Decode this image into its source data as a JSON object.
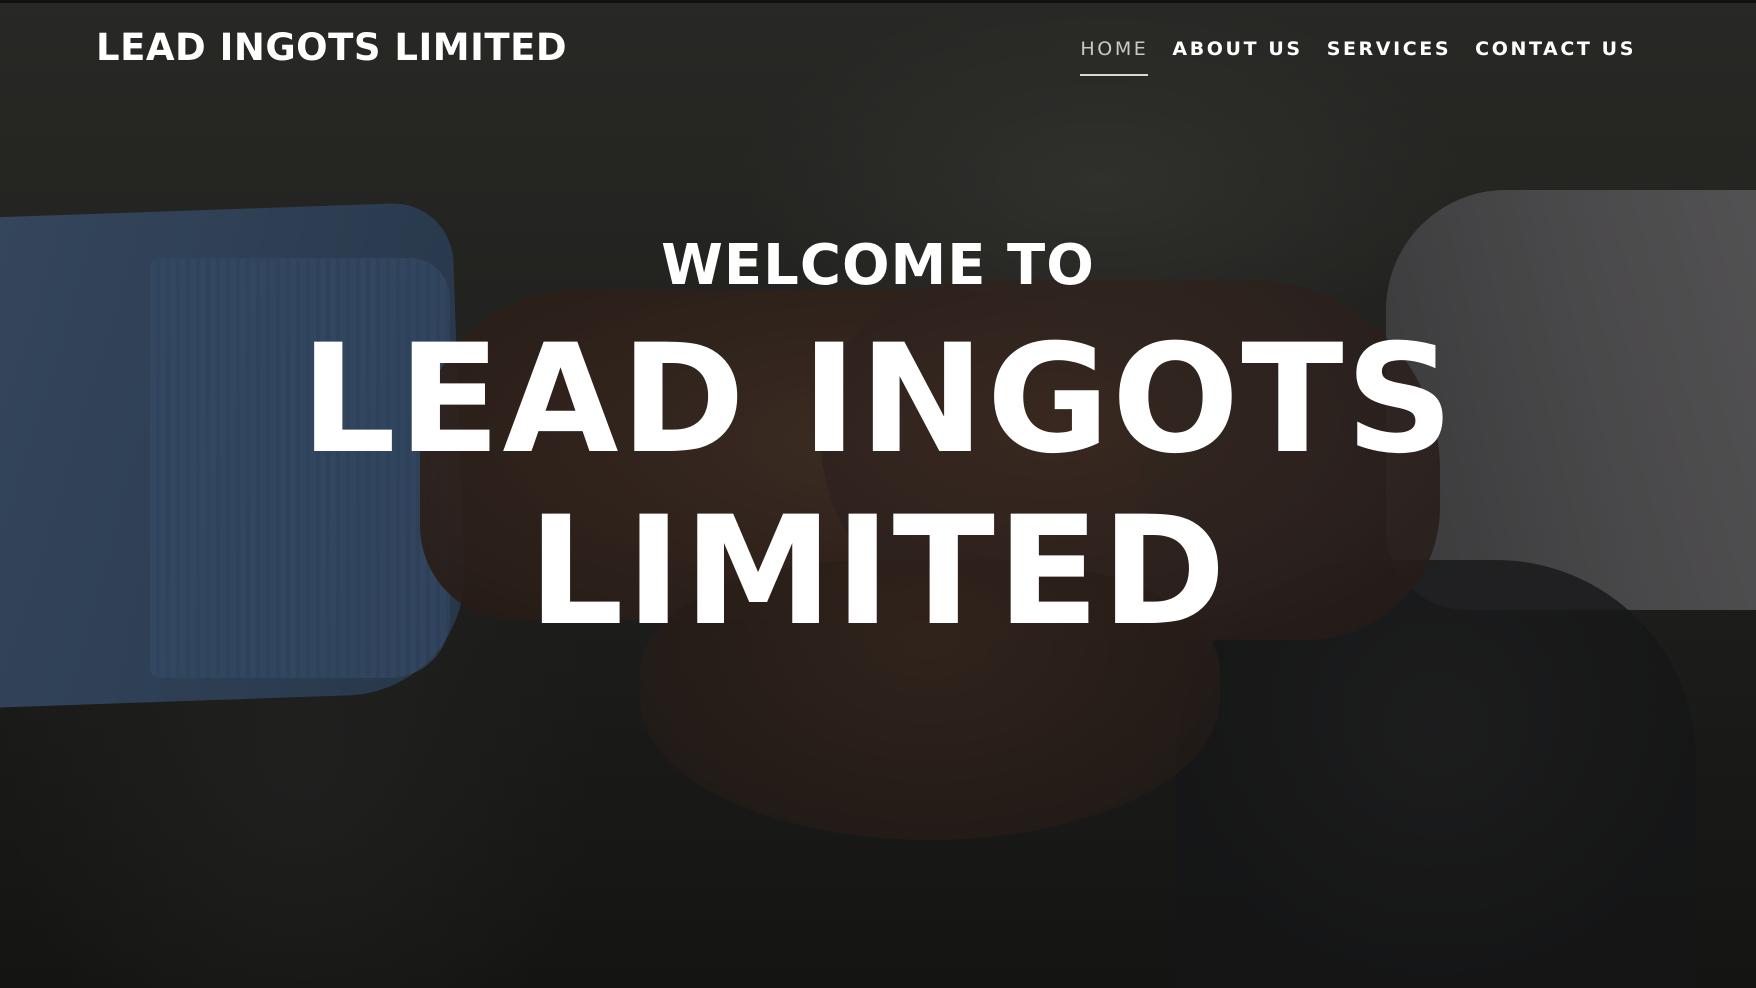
{
  "header": {
    "brand": "LEAD INGOTS LIMITED",
    "nav": [
      {
        "label": "HOME",
        "active": true
      },
      {
        "label": "ABOUT US",
        "active": false
      },
      {
        "label": "SERVICES",
        "active": false
      },
      {
        "label": "CONTACT US",
        "active": false
      }
    ]
  },
  "hero": {
    "eyebrow": "WELCOME TO",
    "title": "LEAD INGOTS LIMITED",
    "background_image": "handshake-photo"
  },
  "colors": {
    "text": "#ffffff",
    "overlay": "#0c0c0c",
    "active_nav_underline": "#d8d8d8"
  }
}
